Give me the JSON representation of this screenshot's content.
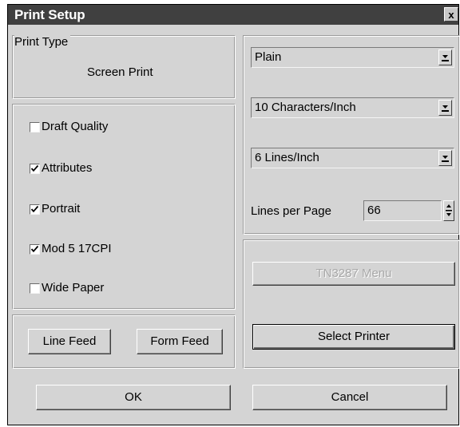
{
  "window": {
    "title": "Print Setup",
    "close_glyph": "x"
  },
  "print_type": {
    "label": "Print Type",
    "value": "Screen Print"
  },
  "options": [
    {
      "label": "Draft Quality",
      "checked": false
    },
    {
      "label": "Attributes",
      "checked": true
    },
    {
      "label": "Portrait",
      "checked": true
    },
    {
      "label": "Mod 5 17CPI",
      "checked": true
    },
    {
      "label": "Wide Paper",
      "checked": false
    }
  ],
  "feed_buttons": {
    "line_feed": "Line Feed",
    "form_feed": "Form Feed"
  },
  "font_style": {
    "value": "Plain"
  },
  "char_density": {
    "value": "10 Characters/Inch"
  },
  "line_density": {
    "value": "6 Lines/Inch"
  },
  "lines_per_page": {
    "label": "Lines per Page",
    "value": "66"
  },
  "tn3287_button": {
    "label": "TN3287 Menu",
    "enabled": false
  },
  "select_printer_button": {
    "label": "Select Printer"
  },
  "footer": {
    "ok": "OK",
    "cancel": "Cancel"
  },
  "icons": {
    "close": "close-icon",
    "dropdown": "dropdown-arrow-icon",
    "checkmark": "checkmark-icon",
    "spinner": "spinner-arrows-icon"
  }
}
